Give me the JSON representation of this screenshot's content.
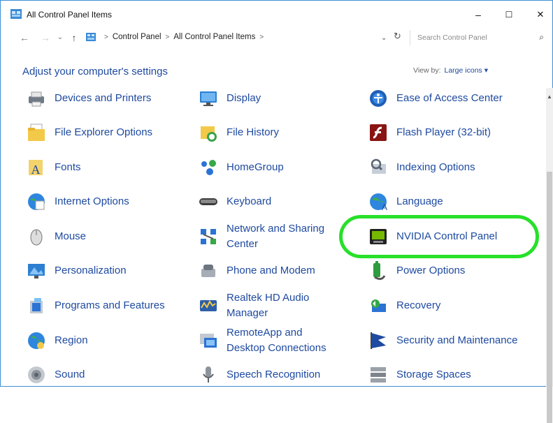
{
  "window": {
    "title": "All Control Panel Items",
    "minimize": "–",
    "maximize": "☐",
    "close": "✕"
  },
  "address": {
    "back": "←",
    "forward": "→",
    "dropdown": "⌄",
    "up": "↑",
    "crumbs": [
      "Control Panel",
      "All Control Panel Items"
    ],
    "separator": ">",
    "refresh": "↻",
    "search_placeholder": "Search Control Panel",
    "search_glyph": "⌕"
  },
  "heading": "Adjust your computer's settings",
  "view_by": {
    "label": "View by:",
    "value": "Large icons ▾"
  },
  "scroll_up": "▲",
  "items": [
    {
      "label": "Devices and Printers",
      "icon": "printer-icon"
    },
    {
      "label": "Display",
      "icon": "monitor-icon"
    },
    {
      "label": "Ease of Access Center",
      "icon": "ease-of-access-icon"
    },
    {
      "label": "File Explorer Options",
      "icon": "folder-icon"
    },
    {
      "label": "File History",
      "icon": "file-history-icon"
    },
    {
      "label": "Flash Player (32-bit)",
      "icon": "flash-icon"
    },
    {
      "label": "Fonts",
      "icon": "fonts-icon"
    },
    {
      "label": "HomeGroup",
      "icon": "homegroup-icon"
    },
    {
      "label": "Indexing Options",
      "icon": "indexing-icon"
    },
    {
      "label": "Internet Options",
      "icon": "globe-icon"
    },
    {
      "label": "Keyboard",
      "icon": "keyboard-icon"
    },
    {
      "label": "Language",
      "icon": "language-icon"
    },
    {
      "label": "Mouse",
      "icon": "mouse-icon"
    },
    {
      "label": "Network and Sharing Center",
      "icon": "network-icon"
    },
    {
      "label": "NVIDIA Control Panel",
      "icon": "nvidia-icon"
    },
    {
      "label": "Personalization",
      "icon": "personalization-icon"
    },
    {
      "label": "Phone and Modem",
      "icon": "phone-icon"
    },
    {
      "label": "Power Options",
      "icon": "power-icon"
    },
    {
      "label": "Programs and Features",
      "icon": "programs-icon"
    },
    {
      "label": "Realtek HD Audio Manager",
      "icon": "audio-icon"
    },
    {
      "label": "Recovery",
      "icon": "recovery-icon"
    },
    {
      "label": "Region",
      "icon": "region-icon"
    },
    {
      "label": "RemoteApp and Desktop Connections",
      "icon": "remoteapp-icon"
    },
    {
      "label": "Security and Maintenance",
      "icon": "flag-icon"
    },
    {
      "label": "Sound",
      "icon": "speaker-icon"
    },
    {
      "label": "Speech Recognition",
      "icon": "microphone-icon"
    },
    {
      "label": "Storage Spaces",
      "icon": "storage-icon"
    }
  ],
  "highlight_color": "#27e02a",
  "link_color": "#1e4aa0"
}
